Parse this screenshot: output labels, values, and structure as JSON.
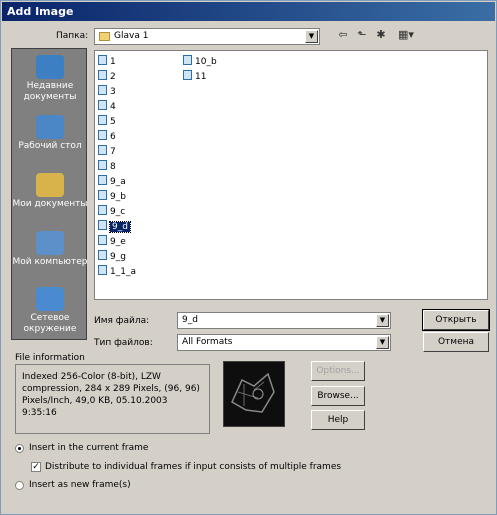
{
  "window": {
    "title": "Add Image"
  },
  "lookin": {
    "label": "Папка:",
    "value": "Glava 1"
  },
  "places": [
    {
      "name": "place-recent",
      "label": "Недавние документы",
      "color": "#3c7fc2"
    },
    {
      "name": "place-desktop",
      "label": "Рабочий стол",
      "color": "#4b86c6"
    },
    {
      "name": "place-mydocs",
      "label": "Мои документы",
      "color": "#d8b24a"
    },
    {
      "name": "place-mycomputer",
      "label": "Мой компьютер",
      "color": "#5d8fc8"
    },
    {
      "name": "place-network",
      "label": "Сетевое окружение",
      "color": "#4a8ad0"
    }
  ],
  "files_col1": [
    "1",
    "2",
    "3",
    "4",
    "5",
    "6",
    "7",
    "8",
    "9_a",
    "9_b",
    "9_c",
    "9_d",
    "9_e",
    "9_g",
    "1_1_a"
  ],
  "files_col2": [
    "10_b",
    "11"
  ],
  "selected_file": "9_d",
  "filename": {
    "label": "Имя файла:",
    "value": "9_d"
  },
  "filetype": {
    "label": "Тип файлов:",
    "value": "All Formats"
  },
  "buttons": {
    "open": "Открыть",
    "cancel": "Отмена",
    "options": "Options...",
    "browse": "Browse...",
    "help": "Help"
  },
  "fileinfo": {
    "title": "File information",
    "line1": "Indexed 256-Color (8-bit), LZW",
    "line2": "compression, 284 x 289 Pixels, (96, 96)",
    "line3": "Pixels/Inch, 49,0 KB,  05.10.2003",
    "line4": "9:35:16"
  },
  "options": {
    "insert_current": "Insert in the current frame",
    "distribute": "Distribute to individual frames if input consists of multiple frames",
    "insert_new": "Insert as new frame(s)"
  }
}
